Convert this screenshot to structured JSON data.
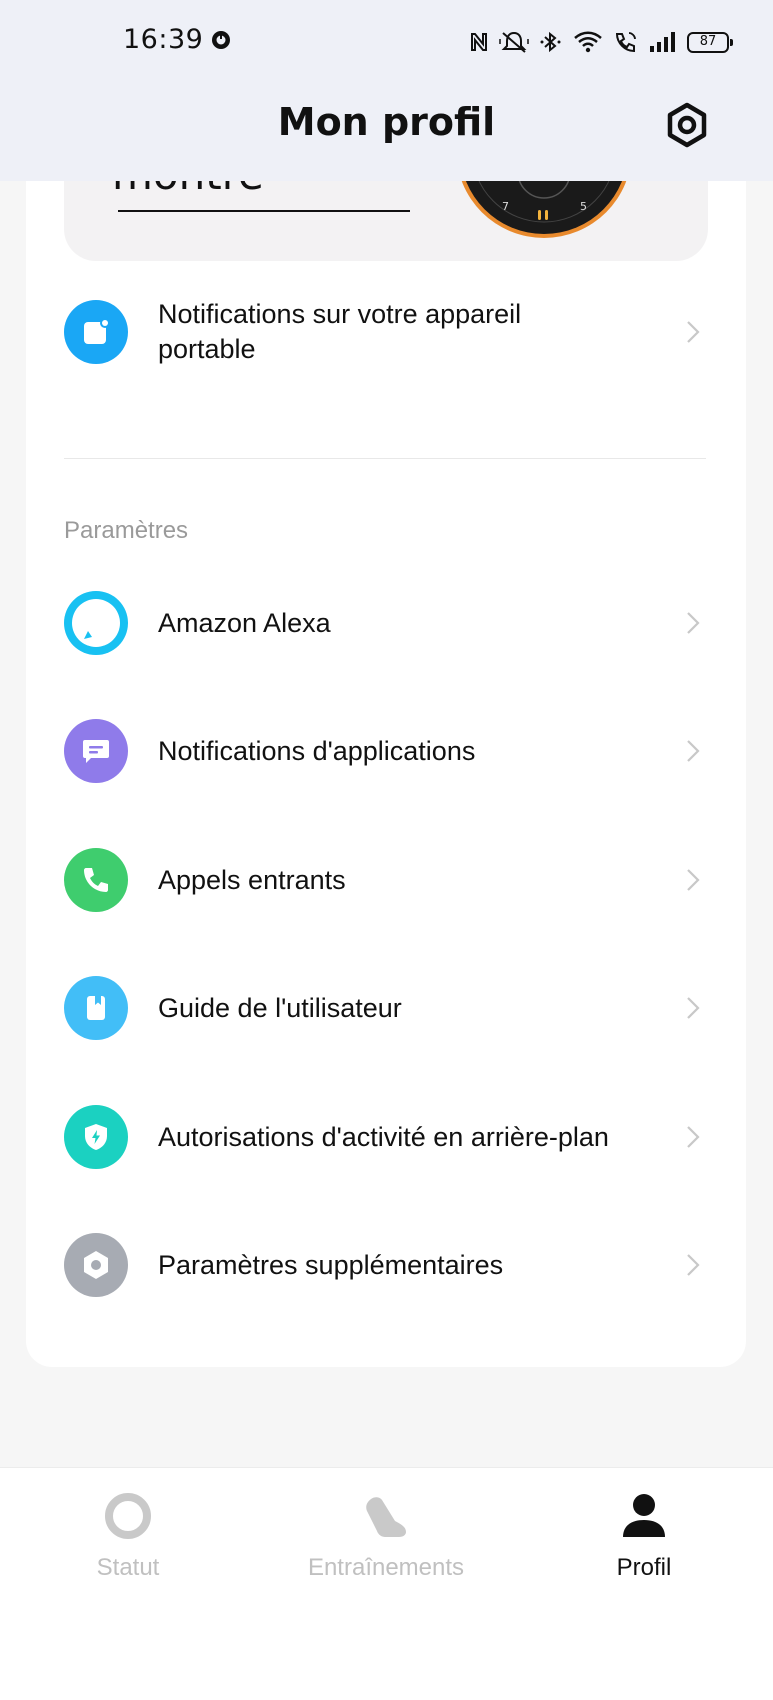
{
  "status_bar": {
    "time": "16:39",
    "battery": "87",
    "icons": [
      "app-notification-icon",
      "nfc-icon",
      "mute-icon",
      "bluetooth-icon",
      "wifi-icon",
      "wifi-call-icon",
      "signal-icon",
      "battery-icon"
    ]
  },
  "header": {
    "title": "Mon profil",
    "settings_icon": "settings-icon"
  },
  "watch_panel": {
    "text": "montre",
    "face_numbers": [
      "7",
      "5"
    ]
  },
  "device_row": {
    "label": "Notifications sur votre appareil portable",
    "icon": "device-notification-icon",
    "color": "#1aa7f5"
  },
  "settings": {
    "section_title": "Paramètres",
    "items": [
      {
        "label": "Amazon Alexa",
        "icon": "alexa-icon",
        "color": "#18c1f2"
      },
      {
        "label": "Notifications d'applications",
        "icon": "message-icon",
        "color": "#8f7bea"
      },
      {
        "label": "Appels entrants",
        "icon": "phone-icon",
        "color": "#3fcd6e"
      },
      {
        "label": "Guide de l'utilisateur",
        "icon": "book-icon",
        "color": "#42bef7"
      },
      {
        "label": "Autorisations d'activité en arrière-plan",
        "icon": "shield-icon",
        "color": "#1bd1c1"
      },
      {
        "label": "Paramètres supplémentaires",
        "icon": "hexagon-settings-icon",
        "color": "#a7abb3"
      }
    ]
  },
  "bottom_nav": {
    "tabs": [
      {
        "label": "Statut",
        "icon": "ring-icon",
        "active": false
      },
      {
        "label": "Entraînements",
        "icon": "shoe-icon",
        "active": false
      },
      {
        "label": "Profil",
        "icon": "person-icon",
        "active": true
      }
    ]
  },
  "system_nav": {
    "buttons": [
      "back-icon",
      "home-icon",
      "menu-icon"
    ]
  }
}
